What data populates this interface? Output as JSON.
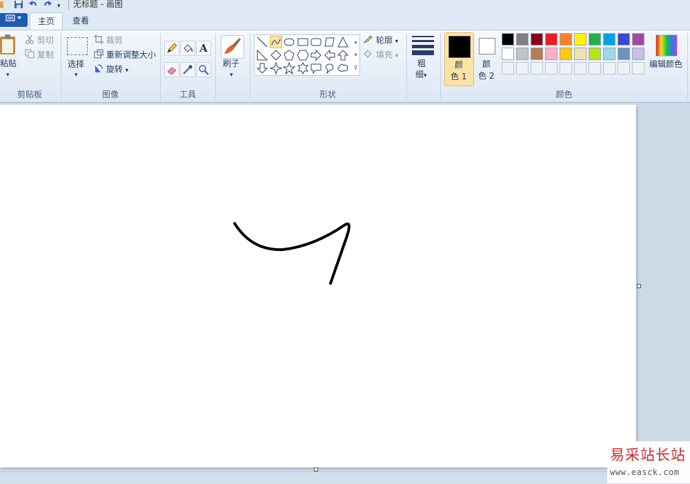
{
  "window": {
    "title": "无标题 - 画图"
  },
  "quick_access": {
    "icons": [
      "save-icon",
      "undo-icon",
      "redo-icon",
      "customize-dropdown-icon"
    ]
  },
  "tabs": [
    {
      "label": "主页",
      "active": true
    },
    {
      "label": "查看",
      "active": false
    }
  ],
  "ribbon": {
    "clipboard": {
      "paste_label": "粘贴",
      "cut_label": "剪切",
      "copy_label": "复制",
      "group_label": "剪贴板"
    },
    "image": {
      "select_label": "选择",
      "crop_label": "裁剪",
      "resize_label": "重新调整大小",
      "rotate_label": "旋转",
      "group_label": "图像"
    },
    "tools": {
      "group_label": "工具",
      "icons": [
        "pencil-icon",
        "fill-icon",
        "text-icon",
        "eraser-icon",
        "color-picker-icon",
        "magnifier-icon"
      ]
    },
    "brushes": {
      "label": "刷子"
    },
    "shapes": {
      "group_label": "形状",
      "outline_label": "轮廓",
      "fill_label": "填充",
      "selected": "curve",
      "items": [
        "line",
        "curve",
        "oval",
        "rectangle",
        "rounded-rectangle",
        "polygon",
        "triangle",
        "right-triangle",
        "diamond",
        "pentagon",
        "hexagon",
        "right-arrow",
        "left-arrow",
        "up-arrow",
        "down-arrow",
        "four-point-star",
        "five-point-star",
        "six-point-star",
        "rounded-callout",
        "oval-callout",
        "cloud-callout"
      ]
    },
    "size": {
      "label_line1": "粗",
      "label_line2": "细"
    },
    "colors": {
      "color1_label_line1": "颜",
      "color1_label_line2": "色 1",
      "color2_label_line1": "颜",
      "color2_label_line2": "色 2",
      "color1_value": "#000000",
      "color2_value": "#ffffff",
      "group_label": "颜色",
      "edit_label": "编辑颜色",
      "palette_row1": [
        "#000000",
        "#7f7f7f",
        "#880015",
        "#ed1c24",
        "#ff7f27",
        "#fff200",
        "#22b14c",
        "#00a2e8",
        "#3f48cc",
        "#a349a4"
      ],
      "palette_row2": [
        "#ffffff",
        "#c3c3c3",
        "#b97a57",
        "#ffaec9",
        "#ffc90e",
        "#efe4b0",
        "#b5e61d",
        "#99d9ea",
        "#7092be",
        "#c8bfe7"
      ]
    }
  },
  "canvas": {
    "background": "#ffffff",
    "stroke_color": "#000000"
  },
  "watermark": {
    "title": "易采站长站",
    "url": "www.easck.com"
  }
}
